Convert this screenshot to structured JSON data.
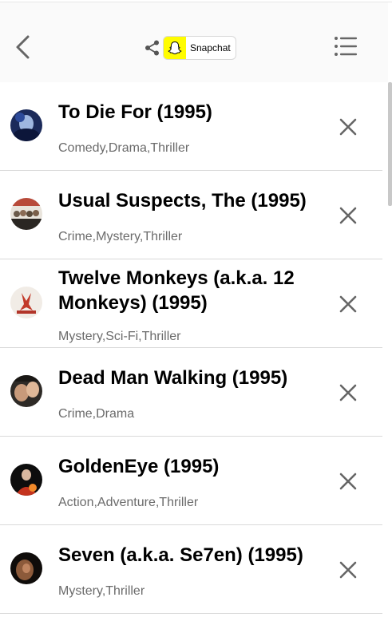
{
  "header": {
    "share_label": "Snapchat"
  },
  "movies": [
    {
      "title": "To Die For (1995)",
      "genres": "Comedy,Drama,Thriller"
    },
    {
      "title": "Usual Suspects, The (1995)",
      "genres": "Crime,Mystery,Thriller"
    },
    {
      "title": "Twelve Monkeys (a.k.a. 12 Monkeys) (1995)",
      "genres": "Mystery,Sci-Fi,Thriller"
    },
    {
      "title": "Dead Man Walking (1995)",
      "genres": "Crime,Drama"
    },
    {
      "title": "GoldenEye (1995)",
      "genres": "Action,Adventure,Thriller"
    },
    {
      "title": "Seven (a.k.a. Se7en) (1995)",
      "genres": "Mystery,Thriller"
    }
  ],
  "icons": {
    "back": "chevron-left-icon",
    "share": "share-icon",
    "snapchat": "snapchat-ghost-icon",
    "menu": "list-menu-icon",
    "remove": "close-icon"
  },
  "colors": {
    "snapchat_yellow": "#fffc00",
    "genre_text": "#6b6b6b",
    "divider": "#d9d9d9"
  }
}
